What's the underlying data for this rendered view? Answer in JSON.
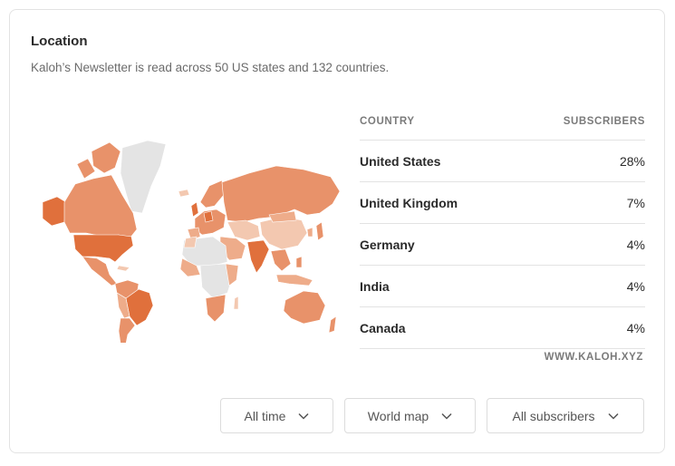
{
  "card": {
    "title": "Location",
    "subtitle": "Kaloh’s Newsletter is read across 50 US states and 132 countries."
  },
  "table": {
    "col_country": "COUNTRY",
    "col_subscribers": "SUBSCRIBERS",
    "rows": [
      {
        "country": "United States",
        "share": "28%"
      },
      {
        "country": "United Kingdom",
        "share": "7%"
      },
      {
        "country": "Germany",
        "share": "4%"
      },
      {
        "country": "India",
        "share": "4%"
      },
      {
        "country": "Canada",
        "share": "4%"
      }
    ]
  },
  "watermark": "WWW.KALOH.XYZ",
  "filters": {
    "time": "All time",
    "view": "World map",
    "audience": "All subscribers"
  },
  "map_colors": {
    "highest": "#e0703c",
    "high": "#e8926a",
    "medium": "#eeac8a",
    "low": "#f3c8b0",
    "none": "#e4e4e4"
  }
}
